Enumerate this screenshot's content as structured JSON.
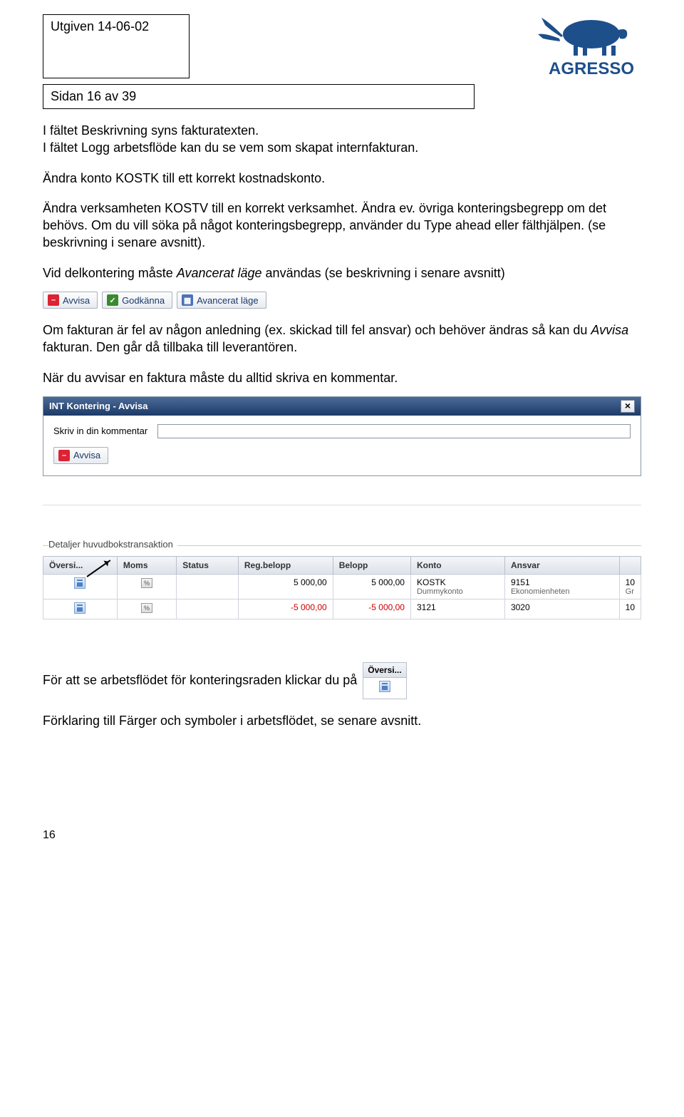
{
  "header": {
    "issued": "Utgiven 14-06-02",
    "pageInfo": "Sidan 16 av 39",
    "logoText": "AGRESSO"
  },
  "paragraphs": {
    "p1a": "I fältet Beskrivning syns fakturatexten.",
    "p1b": "I fältet Logg arbetsflöde kan du se vem som skapat internfakturan.",
    "p2": "Ändra konto KOSTK till ett korrekt kostnadskonto.",
    "p3": "Ändra verksamheten KOSTV till en korrekt verksamhet. Ändra ev. övriga konteringsbegrepp om det behövs. Om du vill söka på något konteringsbegrepp, använder du Type ahead eller fälthjälpen. (se beskrivning i senare avsnitt).",
    "p4a": "Vid delkontering måste ",
    "p4b": "Avancerat läge",
    "p4c": " användas (se beskrivning i senare avsnitt)",
    "p5a": "Om fakturan är fel av någon anledning (ex. skickad till fel ansvar) och behöver ändras så kan du ",
    "p5b": "Avvisa",
    "p5c": " fakturan. Den går då tillbaka till leverantören.",
    "p6": "När du avvisar en faktura måste du alltid skriva en kommentar.",
    "p7": "För att se arbetsflödet för konteringsraden klickar du på",
    "p8": "Förklaring till Färger och symboler i arbetsflödet, se senare avsnitt."
  },
  "buttons": {
    "reject": "Avvisa",
    "approve": "Godkänna",
    "advanced": "Avancerat läge"
  },
  "dialog": {
    "title": "INT Kontering - Avvisa",
    "fieldLabel": "Skriv in din kommentar",
    "inputValue": "",
    "buttonLabel": "Avvisa"
  },
  "tableSection": {
    "legend": "Detaljer huvudbokstransaktion",
    "headers": [
      "Översi...",
      "Moms",
      "Status",
      "Reg.belopp",
      "Belopp",
      "Konto",
      "Ansvar"
    ],
    "rows": [
      {
        "status": "",
        "regbelopp": "5 000,00",
        "belopp": "5 000,00",
        "konto": "KOSTK",
        "kontoSub": "Dummykonto",
        "ansvar": "9151",
        "ansvarSub": "Ekonomienheten",
        "trail": "10",
        "trailSub": "Gr",
        "red": false
      },
      {
        "status": "",
        "regbelopp": "-5 000,00",
        "belopp": "-5 000,00",
        "konto": "3121",
        "kontoSub": "",
        "ansvar": "3020",
        "ansvarSub": "",
        "trail": "10",
        "trailSub": "",
        "red": true
      }
    ]
  },
  "miniTable": {
    "header": "Översi..."
  },
  "footerPage": "16"
}
